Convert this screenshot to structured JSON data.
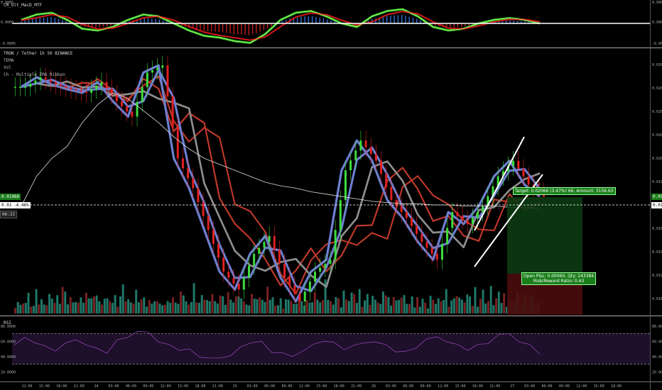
{
  "chart_data": [
    {
      "type": "area",
      "panel": "oscillator",
      "title": "CM_Ult_MacD_MTF",
      "y_ticks": [
        "0.0005",
        "0.0000",
        "-0.0005"
      ],
      "ylim": [
        -0.0006,
        0.0006
      ],
      "series": [
        {
          "name": "",
          "values": [
            0.0001,
            0.00025,
            0.0003,
            0.0001,
            -0.00015,
            -0.0002,
            -0.0001,
            0.0001,
            0.00025,
            0.0002,
            0.0,
            -0.0002,
            -0.00035,
            -0.0004,
            -0.0005,
            -0.00055,
            -0.0003,
            0.0001,
            0.0003,
            0.00035,
            0.0002,
            0.0,
            -0.0001,
            0.0002,
            0.00035,
            0.0004,
            0.0002,
            -0.0001,
            -0.0002,
            -0.00015,
            0.0,
            0.0001,
            0.00015,
            0.0001,
            0.0
          ]
        }
      ]
    },
    {
      "type": "line",
      "panel": "price",
      "title": "TRON / Tether  1h  50  BINANCE",
      "legend": [
        "TEMA",
        "Vol",
        "Ch - Multiple_EMA_Ribbon"
      ],
      "y_ticks": [
        "0.02080",
        "0.02060",
        "0.02040",
        "0.02020",
        "0.02000",
        "0.01980",
        "0.01960",
        "0.01940",
        "0.01920",
        "0.01900",
        "0.01880"
      ],
      "ylim": [
        0.0187,
        0.0209
      ],
      "x_ticks": [
        "12:00",
        "15:00",
        "18:00",
        "21:00",
        "24",
        "03:00",
        "06:00",
        "09:00",
        "12:00",
        "15:00",
        "18:00",
        "21:00",
        "25",
        "03:00",
        "06:00",
        "09:00",
        "12:00",
        "15:00",
        "18:00",
        "21:00",
        "26",
        "03:00",
        "06:00",
        "09:00",
        "12:00",
        "15:00",
        "18:00",
        "21:00",
        "27",
        "03:00",
        "06:00",
        "09:00",
        "12:00",
        "15:00",
        "18:00"
      ],
      "series": [
        {
          "name": "",
          "values": [
            0.0206,
            0.02068,
            0.02062,
            0.02058,
            0.02055,
            0.02064,
            0.02048,
            0.02035,
            0.02072,
            0.02078,
            0.02,
            0.01975,
            0.0194,
            0.01905,
            0.0189,
            0.0192,
            0.01935,
            0.019,
            0.0188,
            0.01905,
            0.01915,
            0.0199,
            0.02015,
            0.01998,
            0.01965,
            0.0195,
            0.0193,
            0.01915,
            0.01955,
            0.01945,
            0.0196,
            0.01985,
            0.01998,
            0.01978,
            0.01968
          ]
        }
      ],
      "ma_series": {
        "name": "",
        "values": [
          0.0196,
          0.01985,
          0.02,
          0.0201,
          0.0203,
          0.02045,
          0.02055,
          0.0205,
          0.0204,
          0.0203,
          0.02018,
          0.02008,
          0.02,
          0.01995,
          0.0199,
          0.01985,
          0.0198,
          0.01977,
          0.01975,
          0.01972,
          0.0197,
          0.01968,
          0.01966,
          0.01964,
          0.01963,
          0.01962,
          0.01962,
          0.01961,
          0.01961,
          0.0196,
          0.0196,
          0.0196,
          0.01959,
          0.01959,
          0.01958
        ]
      },
      "price_tags": {
        "upper": "0.01966",
        "current": "0.01962",
        "current_extra": "-4.46%",
        "time": "06:22"
      },
      "position": {
        "target_text": "Target: 0.02066 (3.47%) 66, Amount: 3156.63",
        "open_text": "Open P&L: 0.00060, Qty: 243384",
        "rr_text": "Risk/Reward Ratio: 0.63"
      }
    },
    {
      "type": "bar",
      "panel": "volume",
      "values": [
        5,
        7,
        4,
        8,
        6,
        9,
        5,
        4,
        10,
        6,
        7,
        8,
        5,
        9,
        12,
        6,
        8,
        7,
        14,
        9,
        6,
        8,
        10,
        7,
        5,
        13,
        6,
        9,
        11,
        8,
        7,
        12,
        6,
        8,
        9,
        7,
        10,
        6,
        8,
        5,
        9,
        12,
        8,
        7,
        10,
        6,
        11,
        9,
        8,
        7
      ]
    },
    {
      "type": "line",
      "panel": "rsi",
      "title": "RSI",
      "y_ticks": [
        "80.0000",
        "60.0000",
        "40.0000",
        "20.0000"
      ],
      "ylim": [
        10,
        90
      ],
      "levels": [
        70,
        30
      ],
      "series": [
        {
          "name": "",
          "values": [
            58,
            64,
            60,
            52,
            48,
            55,
            62,
            58,
            50,
            46,
            60,
            66,
            70,
            72,
            62,
            55,
            50,
            48,
            40,
            35,
            38,
            44,
            52,
            60,
            58,
            46,
            42,
            40,
            50,
            55,
            62,
            57,
            50,
            52,
            58,
            62,
            55,
            48,
            45,
            52,
            60,
            66,
            62,
            55,
            50,
            54,
            58,
            66,
            70,
            62,
            55,
            45
          ]
        }
      ]
    }
  ]
}
